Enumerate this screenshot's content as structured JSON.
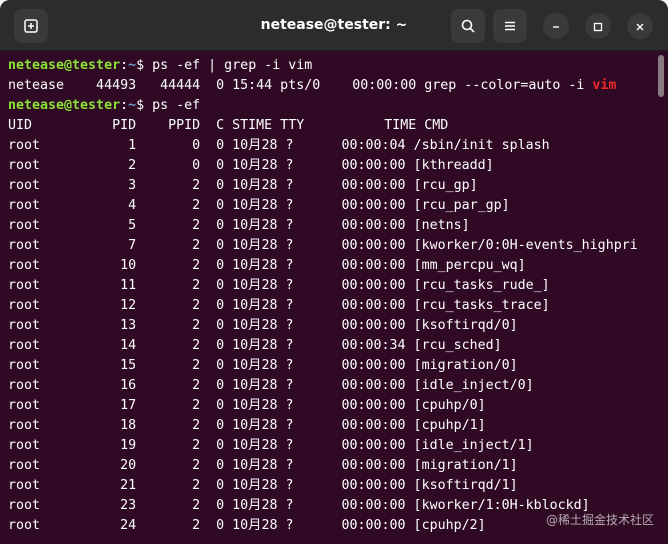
{
  "window": {
    "title": "netease@tester: ~"
  },
  "icons": {
    "new_tab": "new-tab-icon",
    "search": "search-icon",
    "menu": "hamburger-menu-icon",
    "minimize": "minimize-icon",
    "maximize": "maximize-icon",
    "close": "close-icon"
  },
  "colors": {
    "terminal_bg": "#300a24",
    "titlebar_bg": "#2c2c2c",
    "prompt_user": "#8ae234",
    "prompt_path": "#729fcf",
    "match_highlight": "#ef2929",
    "text": "#ffffff"
  },
  "terminal": {
    "cmd1": {
      "user": "netease@tester",
      "sep": ":",
      "path": "~",
      "sym": "$ ",
      "command": "ps -ef | grep -i vim"
    },
    "grep_result": {
      "pre": "netease    44493   44444  0 15:44 pts/0    00:00:00 grep --color=auto -i ",
      "match": "vim"
    },
    "cmd2": {
      "user": "netease@tester",
      "sep": ":",
      "path": "~",
      "sym": "$ ",
      "command": "ps -ef"
    },
    "header": "UID          PID    PPID  C STIME TTY          TIME CMD",
    "rows": [
      "root           1       0  0 10月28 ?      00:00:04 /sbin/init splash",
      "root           2       0  0 10月28 ?      00:00:00 [kthreadd]",
      "root           3       2  0 10月28 ?      00:00:00 [rcu_gp]",
      "root           4       2  0 10月28 ?      00:00:00 [rcu_par_gp]",
      "root           5       2  0 10月28 ?      00:00:00 [netns]",
      "root           7       2  0 10月28 ?      00:00:00 [kworker/0:0H-events_highpri",
      "root          10       2  0 10月28 ?      00:00:00 [mm_percpu_wq]",
      "root          11       2  0 10月28 ?      00:00:00 [rcu_tasks_rude_]",
      "root          12       2  0 10月28 ?      00:00:00 [rcu_tasks_trace]",
      "root          13       2  0 10月28 ?      00:00:00 [ksoftirqd/0]",
      "root          14       2  0 10月28 ?      00:00:34 [rcu_sched]",
      "root          15       2  0 10月28 ?      00:00:00 [migration/0]",
      "root          16       2  0 10月28 ?      00:00:00 [idle_inject/0]",
      "root          17       2  0 10月28 ?      00:00:00 [cpuhp/0]",
      "root          18       2  0 10月28 ?      00:00:00 [cpuhp/1]",
      "root          19       2  0 10月28 ?      00:00:00 [idle_inject/1]",
      "root          20       2  0 10月28 ?      00:00:00 [migration/1]",
      "root          21       2  0 10月28 ?      00:00:00 [ksoftirqd/1]",
      "root          23       2  0 10月28 ?      00:00:00 [kworker/1:0H-kblockd]",
      "root          24       2  0 10月28 ?      00:00:00 [cpuhp/2]"
    ]
  },
  "watermark": "@稀土掘金技术社区"
}
